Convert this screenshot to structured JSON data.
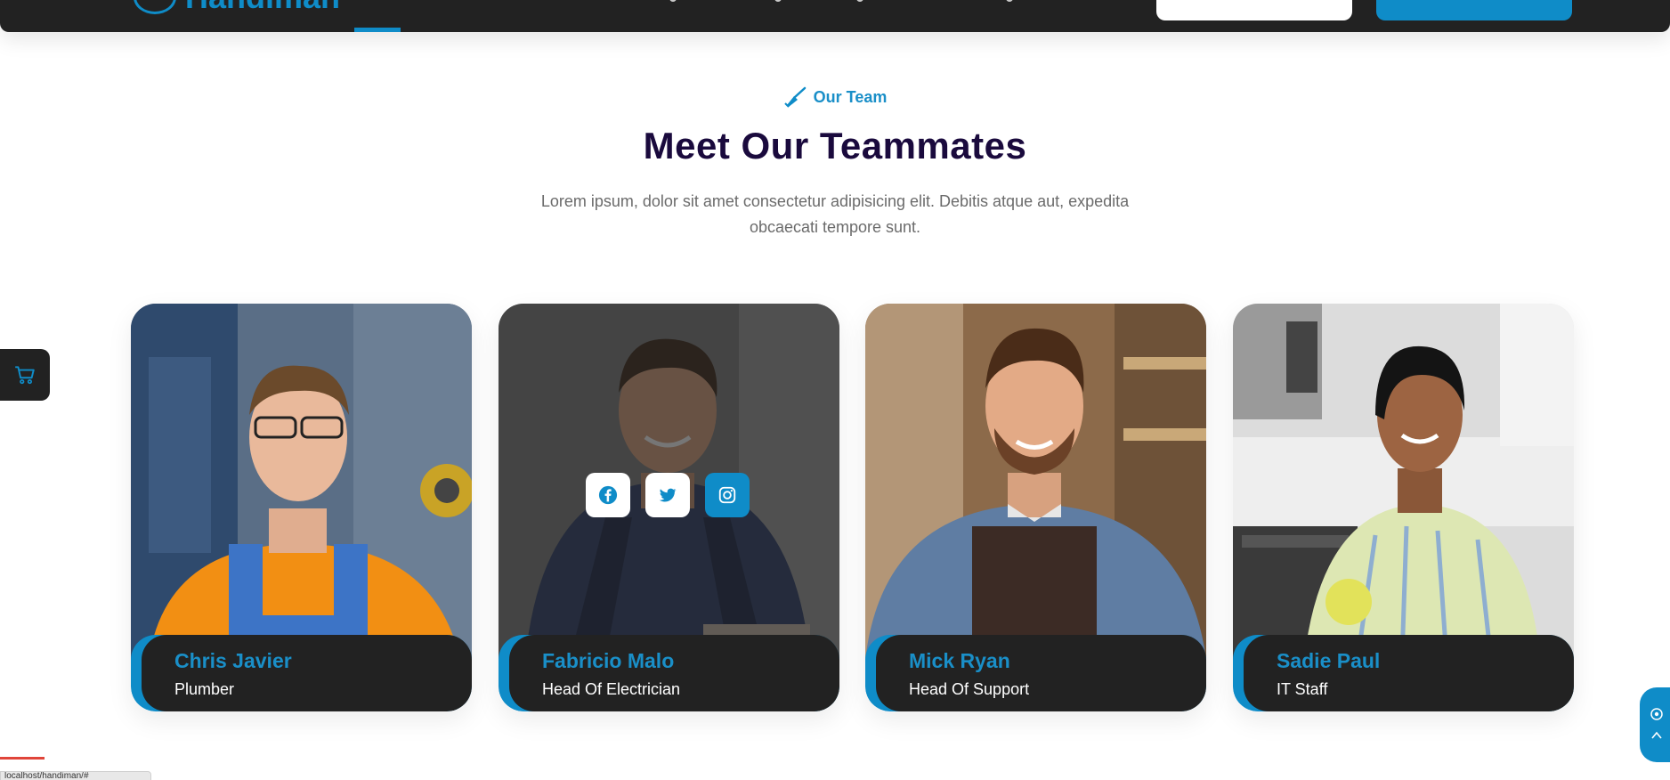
{
  "header": {
    "logo_text": "Handiman"
  },
  "section": {
    "eyebrow": "Our Team",
    "title": "Meet Our Teammates",
    "description": "Lorem ipsum, dolor sit amet consectetur adipisicing elit. Debitis atque aut, expedita obcaecati tempore sunt."
  },
  "team": [
    {
      "name": "Chris Javier",
      "role": "Plumber"
    },
    {
      "name": "Fabricio Malo",
      "role": "Head Of Electrician"
    },
    {
      "name": "Mick Ryan",
      "role": "Head Of Support"
    },
    {
      "name": "Sadie Paul",
      "role": "IT Staff"
    }
  ],
  "socials": [
    "facebook-icon",
    "twitter-icon",
    "instagram-icon"
  ],
  "status_bar": {
    "url": "localhost/handiman/#"
  },
  "colors": {
    "accent": "#0f8cc8",
    "dark": "#222222",
    "title": "#1a0a3d"
  }
}
